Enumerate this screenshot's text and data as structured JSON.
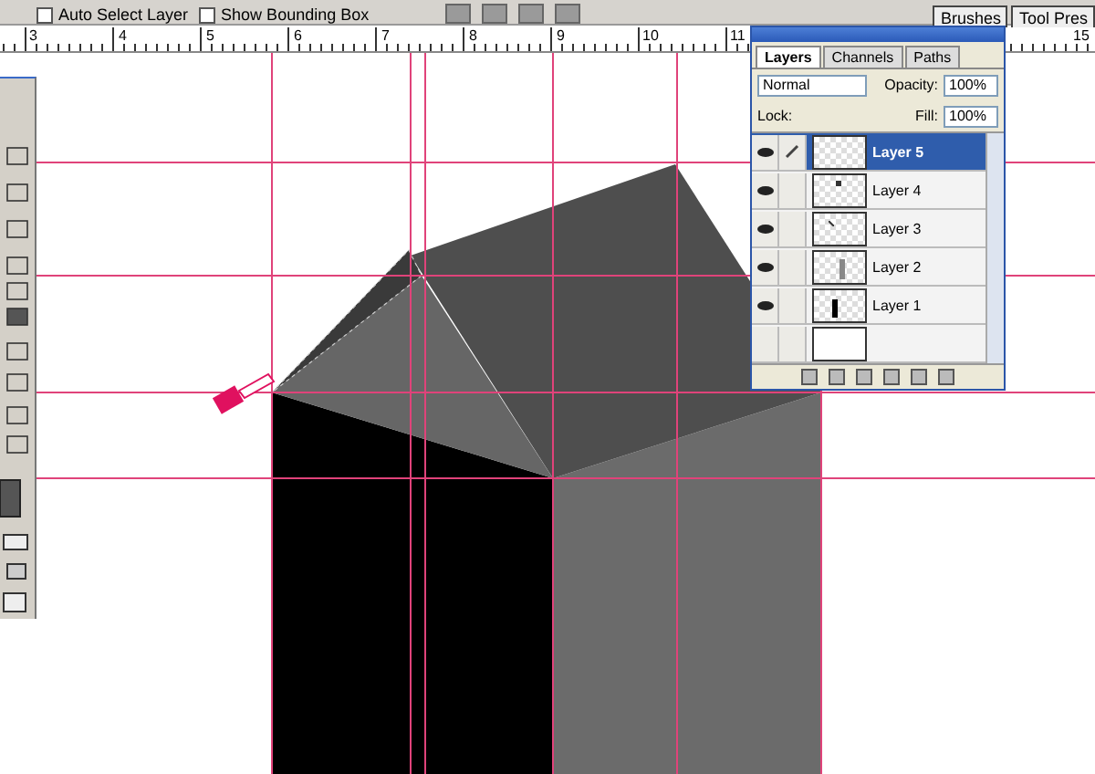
{
  "options_bar": {
    "checkboxes": [
      {
        "label": "Auto Select Layer",
        "checked": false
      },
      {
        "label": "Show Bounding Box",
        "checked": false
      }
    ],
    "palette_tabs": [
      "Brushes",
      "Tool Pres"
    ]
  },
  "ruler": {
    "labels": [
      "3",
      "4",
      "5",
      "6",
      "7",
      "8",
      "9",
      "10",
      "11",
      "15"
    ]
  },
  "layers_panel": {
    "tabs": [
      {
        "label": "Layers",
        "selected": true
      },
      {
        "label": "Channels",
        "selected": false
      },
      {
        "label": "Paths",
        "selected": false
      }
    ],
    "blend_mode": "Normal",
    "opacity_label": "Opacity:",
    "opacity": "100%",
    "lock_label": "Lock:",
    "fill_label": "Fill:",
    "fill": "100%",
    "layers": [
      {
        "name": "Layer 5",
        "visible": true,
        "brush": true,
        "selected": true,
        "kind": "empty"
      },
      {
        "name": "Layer 4",
        "visible": true,
        "brush": false,
        "selected": false,
        "kind": "dot"
      },
      {
        "name": "Layer 3",
        "visible": true,
        "brush": false,
        "selected": false,
        "kind": "tick"
      },
      {
        "name": "Layer 2",
        "visible": true,
        "brush": false,
        "selected": false,
        "kind": "gray-bar"
      },
      {
        "name": "Layer 1",
        "visible": true,
        "brush": false,
        "selected": false,
        "kind": "black-bar"
      },
      {
        "visible": false,
        "brush": false,
        "selected": false,
        "kind": "white"
      }
    ]
  }
}
